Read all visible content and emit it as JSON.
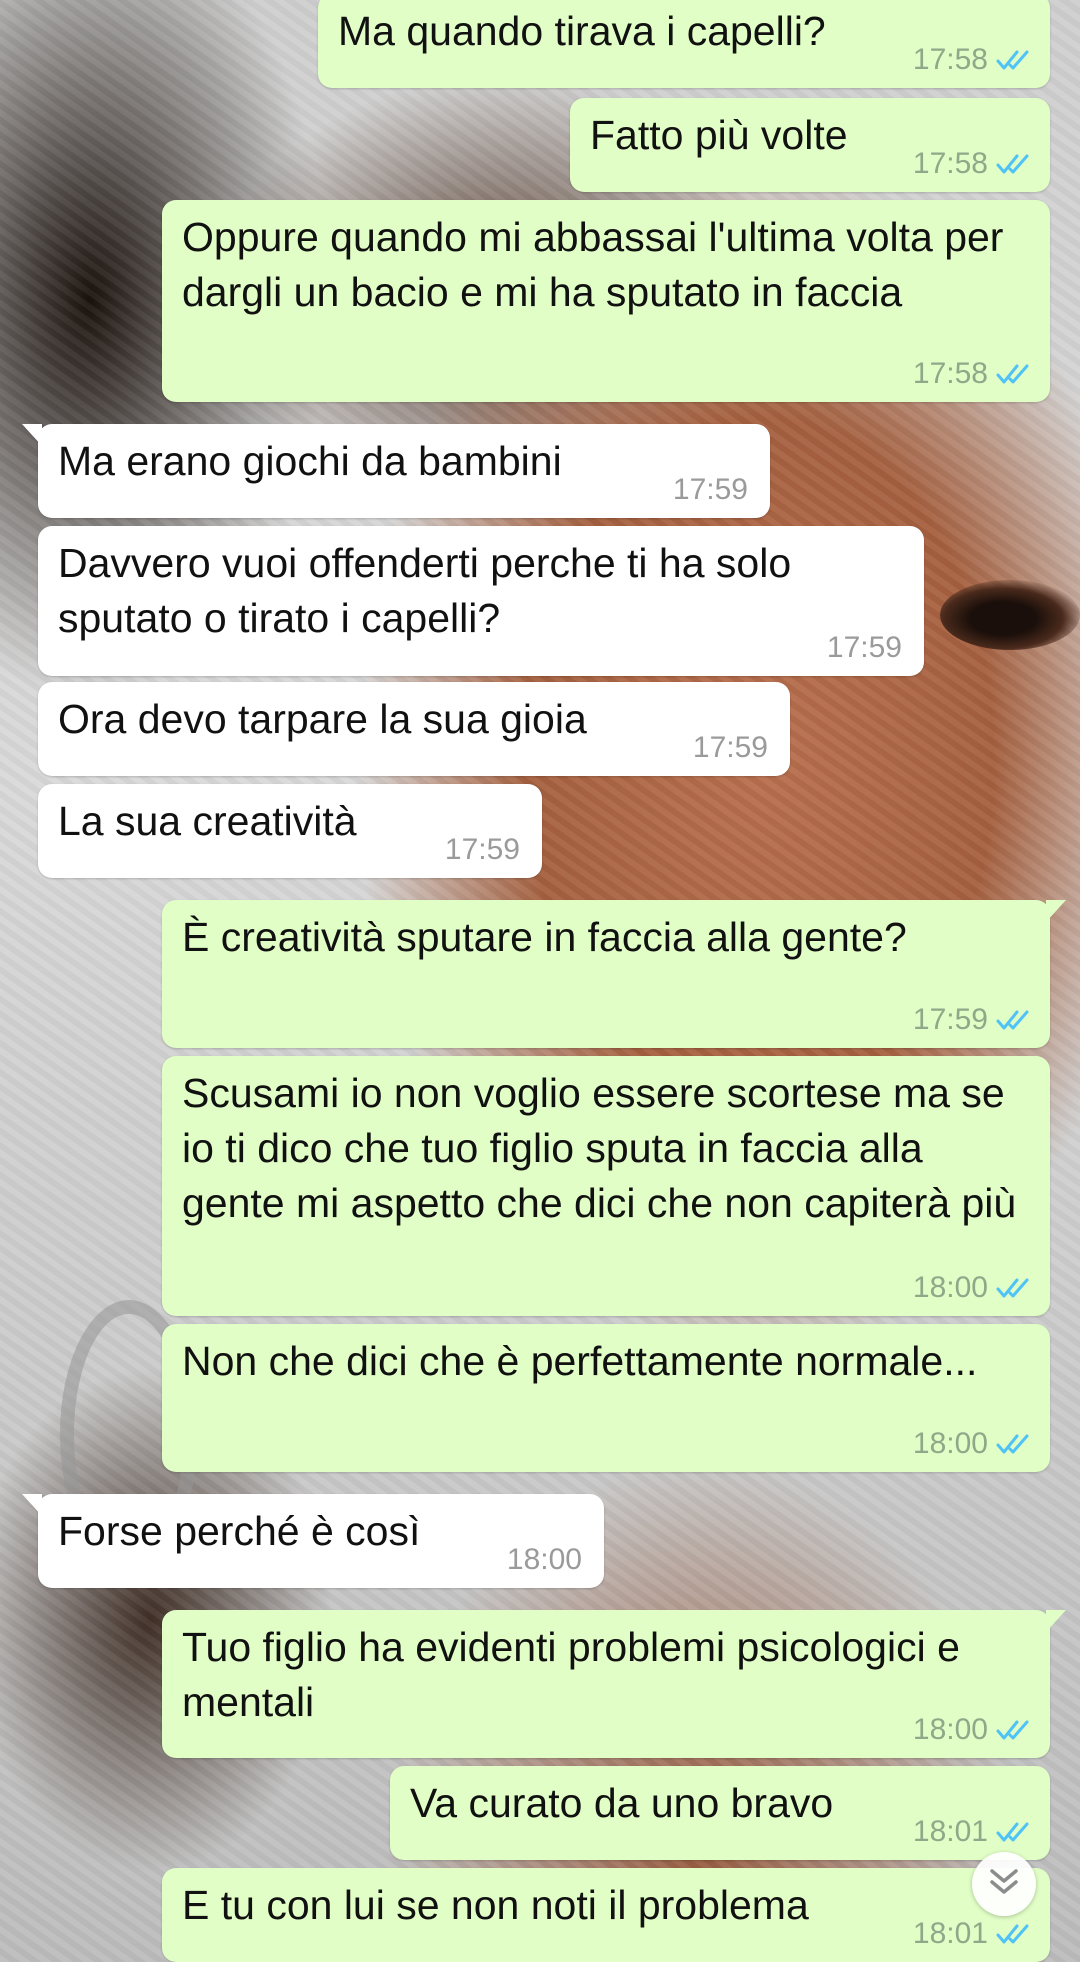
{
  "colors": {
    "outgoing_bubble": "#e1fec6",
    "incoming_bubble": "#ffffff",
    "read_ticks": "#4fc3f7"
  },
  "messages": [
    {
      "direction": "out",
      "text": "Ma quando tirava i capelli?",
      "time": "17:58",
      "status": "read"
    },
    {
      "direction": "out",
      "text": "Fatto più volte",
      "time": "17:58",
      "status": "read"
    },
    {
      "direction": "out",
      "text": "Oppure quando mi abbassai l'ultima volta per dargli un bacio e mi ha sputato in faccia",
      "time": "17:58",
      "status": "read"
    },
    {
      "direction": "in",
      "text": "Ma erano giochi da bambini",
      "time": "17:59"
    },
    {
      "direction": "in",
      "text": "Davvero vuoi offenderti perche ti ha solo sputato o tirato i capelli?",
      "time": "17:59"
    },
    {
      "direction": "in",
      "text": "Ora devo tarpare la sua gioia",
      "time": "17:59"
    },
    {
      "direction": "in",
      "text": "La sua creatività",
      "time": "17:59"
    },
    {
      "direction": "out",
      "text": "È creatività sputare in faccia alla gente?",
      "time": "17:59",
      "status": "read"
    },
    {
      "direction": "out",
      "text": "Scusami io non voglio essere scortese ma se io ti dico che tuo figlio sputa in faccia alla gente mi aspetto che dici che non capiterà più",
      "time": "18:00",
      "status": "read"
    },
    {
      "direction": "out",
      "text": "Non che dici che è perfettamente normale...",
      "time": "18:00",
      "status": "read"
    },
    {
      "direction": "in",
      "text": "Forse perché è così",
      "time": "18:00"
    },
    {
      "direction": "out",
      "text": "Tuo figlio ha evidenti problemi psicologici e mentali",
      "time": "18:00",
      "status": "read"
    },
    {
      "direction": "out",
      "text": "Va curato da uno bravo",
      "time": "18:01",
      "status": "read"
    },
    {
      "direction": "out",
      "text": "E tu con lui se non noti il problema",
      "time": "18:01",
      "status": "read"
    }
  ],
  "scroll_button": {
    "icon": "double-chevron-down-icon"
  }
}
